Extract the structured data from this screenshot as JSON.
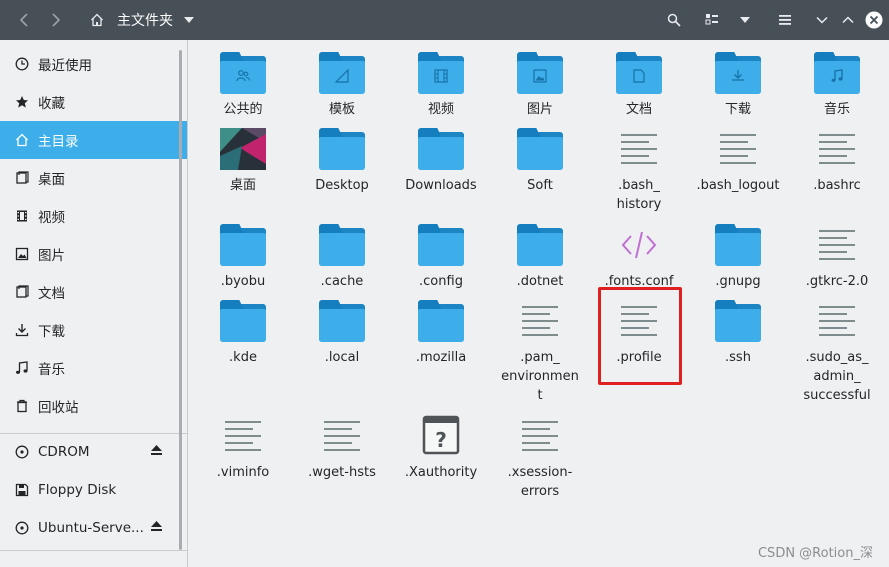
{
  "titlebar": {
    "back_icon": "chevron-left-icon",
    "forward_icon": "chevron-right-icon",
    "home_icon": "home-icon",
    "path": "主文件夹",
    "path_dropdown_icon": "caret-down-icon",
    "search_icon": "search-icon",
    "view_icon": "view-mode-icon",
    "view_dropdown_icon": "caret-down-icon",
    "menu_icon": "hamburger-menu-icon",
    "minimize_icon": "chevron-down-icon",
    "maximize_icon": "chevron-up-icon",
    "close_icon": "close-icon"
  },
  "sidebar": {
    "places": [
      {
        "label": "最近使用",
        "icon": "clock-icon"
      },
      {
        "label": "收藏",
        "icon": "star-icon"
      },
      {
        "label": "主目录",
        "icon": "home-icon",
        "active": true
      },
      {
        "label": "桌面",
        "icon": "desktop-icon"
      },
      {
        "label": "视频",
        "icon": "video-icon"
      },
      {
        "label": "图片",
        "icon": "picture-icon"
      },
      {
        "label": "文档",
        "icon": "document-icon"
      },
      {
        "label": "下载",
        "icon": "download-icon"
      },
      {
        "label": "音乐",
        "icon": "music-icon"
      },
      {
        "label": "回收站",
        "icon": "trash-icon"
      }
    ],
    "devices": [
      {
        "label": "CDROM",
        "icon": "disc-icon",
        "eject": true
      },
      {
        "label": "Floppy Disk",
        "icon": "floppy-icon",
        "eject": false
      },
      {
        "label": "Ubuntu-Serve...",
        "icon": "disc-icon",
        "eject": true
      }
    ]
  },
  "files": [
    {
      "name": "公共的",
      "type": "folder",
      "emblem": "people"
    },
    {
      "name": "模板",
      "type": "folder",
      "emblem": "template"
    },
    {
      "name": "视频",
      "type": "folder",
      "emblem": "video"
    },
    {
      "name": "图片",
      "type": "folder",
      "emblem": "picture"
    },
    {
      "name": "文档",
      "type": "folder",
      "emblem": "document"
    },
    {
      "name": "下载",
      "type": "folder",
      "emblem": "download"
    },
    {
      "name": "音乐",
      "type": "folder",
      "emblem": "music"
    },
    {
      "name": "桌面",
      "type": "desktop"
    },
    {
      "name": "Desktop",
      "type": "folder"
    },
    {
      "name": "Downloads",
      "type": "folder"
    },
    {
      "name": "Soft",
      "type": "folder"
    },
    {
      "name": ".bash_\nhistory",
      "type": "text"
    },
    {
      "name": ".bash_logout",
      "type": "text"
    },
    {
      "name": ".bashrc",
      "type": "text"
    },
    {
      "name": ".byobu",
      "type": "folder"
    },
    {
      "name": ".cache",
      "type": "folder"
    },
    {
      "name": ".config",
      "type": "folder"
    },
    {
      "name": ".dotnet",
      "type": "folder"
    },
    {
      "name": ".fonts.conf",
      "type": "code"
    },
    {
      "name": ".gnupg",
      "type": "folder"
    },
    {
      "name": ".gtkrc-2.0",
      "type": "text"
    },
    {
      "name": ".kde",
      "type": "folder"
    },
    {
      "name": ".local",
      "type": "folder"
    },
    {
      "name": ".mozilla",
      "type": "folder"
    },
    {
      "name": ".pam_\nenvironmen\nt",
      "type": "text"
    },
    {
      "name": ".profile",
      "type": "text"
    },
    {
      "name": ".ssh",
      "type": "folder"
    },
    {
      "name": ".sudo_as_\nadmin_\nsuccessful",
      "type": "text"
    },
    {
      "name": ".viminfo",
      "type": "text"
    },
    {
      "name": ".wget-hsts",
      "type": "text"
    },
    {
      "name": ".Xauthority",
      "type": "unknown"
    },
    {
      "name": ".xsession-\nerrors",
      "type": "text"
    }
  ],
  "watermark": "CSDN @Rotion_深",
  "colors": {
    "accent": "#3daee9",
    "titlebar": "#475057",
    "folder": "#3daee9",
    "highlight": "#e02020"
  }
}
